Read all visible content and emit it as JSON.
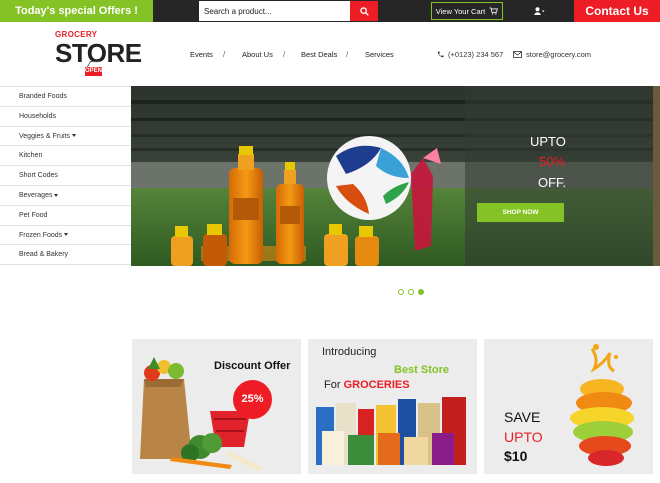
{
  "topbar": {
    "offer_label": "Today's special Offers !",
    "search_placeholder": "Search a product...",
    "cart_label": "View Your Cart",
    "contact_label": "Contact Us"
  },
  "logo": {
    "small": "GROCERY",
    "big": "STORE",
    "sign": "OPEN"
  },
  "nav": {
    "items": [
      {
        "label": "Events"
      },
      {
        "label": "About Us"
      },
      {
        "label": "Best Deals"
      },
      {
        "label": "Services"
      }
    ],
    "separator": "/"
  },
  "contact": {
    "phone": "(+0123) 234 567",
    "email": "store@grocery.com"
  },
  "sidebar": {
    "items": [
      {
        "label": "Branded Foods",
        "dropdown": false
      },
      {
        "label": "Households",
        "dropdown": false
      },
      {
        "label": "Veggies & Fruits",
        "dropdown": true
      },
      {
        "label": "Kitchen",
        "dropdown": false
      },
      {
        "label": "Short Codes",
        "dropdown": false
      },
      {
        "label": "Beverages",
        "dropdown": true
      },
      {
        "label": "Pet Food",
        "dropdown": false
      },
      {
        "label": "Frozen Foods",
        "dropdown": true
      },
      {
        "label": "Bread & Bakery",
        "dropdown": false
      }
    ]
  },
  "banner": {
    "upto": "UPTO",
    "percent": "50%",
    "off": "OFF.",
    "shop_label": "SHOP NOW",
    "slides_count": 3,
    "active_slide": 3
  },
  "cards": {
    "discount": {
      "title": "Discount Offer",
      "badge": "25%"
    },
    "store": {
      "intro": "Introducing",
      "best": "Best Store",
      "for": "For",
      "groceries": "GROCERIES"
    },
    "save": {
      "save": "SAVE",
      "upto": "UPTO",
      "price": "$10"
    }
  },
  "colors": {
    "green": "#84c225",
    "red": "#ee1c25",
    "dark": "#262626"
  },
  "icons": [
    "search-icon",
    "cart-icon",
    "user-icon",
    "phone-icon",
    "mail-icon"
  ]
}
